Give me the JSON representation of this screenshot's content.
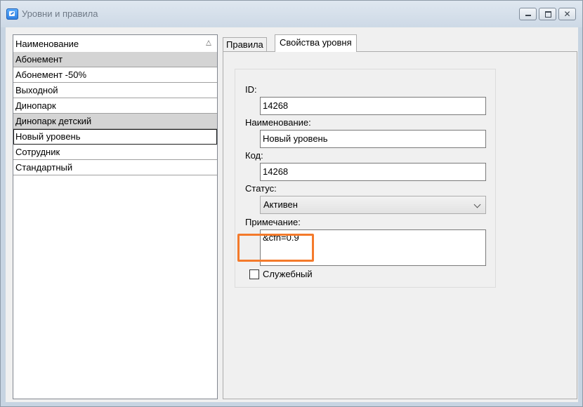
{
  "window": {
    "title": "Уровни и правила",
    "controls": {
      "close_glyph": "✕"
    }
  },
  "list": {
    "column_header": "Наименование",
    "sort_icon": "sort-ascending-icon",
    "items": [
      {
        "label": "Абонемент"
      },
      {
        "label": "Абонемент -50%"
      },
      {
        "label": "Выходной"
      },
      {
        "label": "Динопарк"
      },
      {
        "label": "Динопарк детский"
      },
      {
        "label": "Новый уровень"
      },
      {
        "label": "Сотрудник"
      },
      {
        "label": "Стандартный"
      }
    ]
  },
  "tabs": [
    {
      "label": "Правила"
    },
    {
      "label": "Свойства уровня"
    }
  ],
  "form": {
    "id_label": "ID:",
    "id_value": "14268",
    "name_label": "Наименование:",
    "name_value": "Новый уровень",
    "code_label": "Код:",
    "code_value": "14268",
    "status_label": "Статус:",
    "status_value": "Активен",
    "note_label": "Примечание:",
    "note_value": "&cfn=0.9",
    "service_label": "Служебный"
  },
  "colors": {
    "highlight": "#f47a2b",
    "selected_row": "#d4d4d4"
  }
}
